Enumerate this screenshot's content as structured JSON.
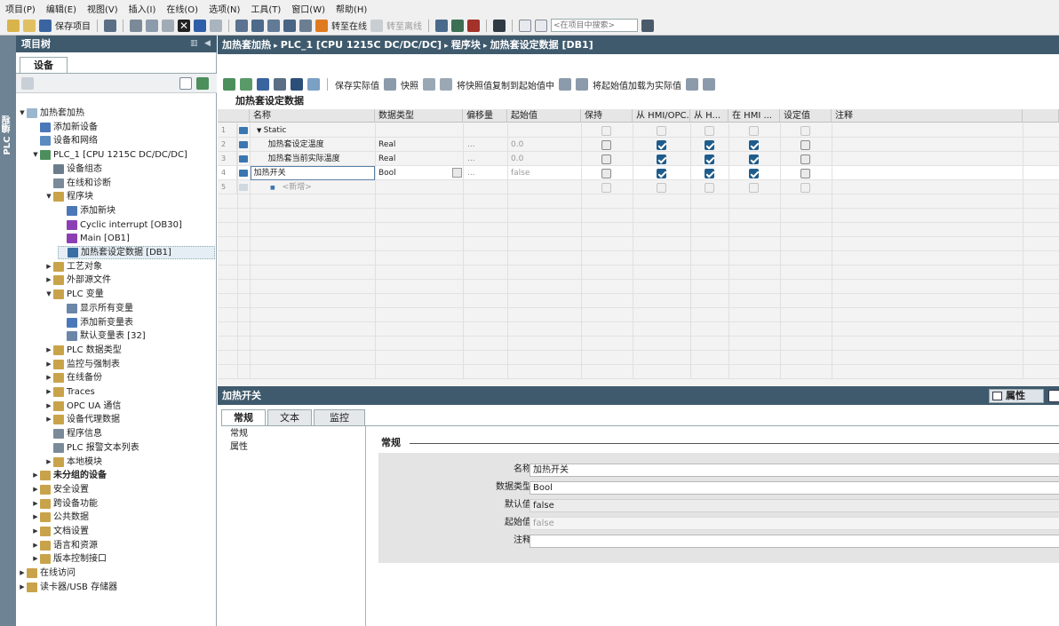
{
  "menu": [
    "项目(P)",
    "编辑(E)",
    "视图(V)",
    "插入(I)",
    "在线(O)",
    "选项(N)",
    "工具(T)",
    "窗口(W)",
    "帮助(H)"
  ],
  "toolbar": {
    "save_project": "保存项目",
    "go_online": "转至在线",
    "go_offline": "转至离线",
    "search_placeholder": "<在项目中搜索>"
  },
  "vertical_tab": "PLC 编程",
  "tree": {
    "header": "项目树",
    "tab_devices": "设备",
    "items": [
      {
        "label": "加热套加热",
        "level": 0,
        "arrow": "▼",
        "color": "#9bb6cf"
      },
      {
        "label": "添加新设备",
        "level": 1,
        "arrow": "",
        "color": "#4b78b8"
      },
      {
        "label": "设备和网络",
        "level": 1,
        "arrow": "",
        "color": "#5b8bc0"
      },
      {
        "label": "PLC_1 [CPU 1215C DC/DC/DC]",
        "level": 1,
        "arrow": "▼",
        "color": "#4c8f5c"
      },
      {
        "label": "设备组态",
        "level": 2,
        "arrow": "",
        "color": "#6b7d8c"
      },
      {
        "label": "在线和诊断",
        "level": 2,
        "arrow": "",
        "color": "#7a8a99"
      },
      {
        "label": "程序块",
        "level": 2,
        "arrow": "▼",
        "color": "#c9a34a"
      },
      {
        "label": "添加新块",
        "level": 3,
        "arrow": "",
        "color": "#4b78b8"
      },
      {
        "label": "Cyclic interrupt [OB30]",
        "level": 3,
        "arrow": "",
        "color": "#8c3fb4"
      },
      {
        "label": "Main [OB1]",
        "level": 3,
        "arrow": "",
        "color": "#8c3fb4"
      },
      {
        "label": "加热套设定数据 [DB1]",
        "level": 3,
        "arrow": "",
        "color": "#3b6ea5",
        "selected": true
      },
      {
        "label": "工艺对象",
        "level": 2,
        "arrow": "▶",
        "color": "#c9a34a"
      },
      {
        "label": "外部源文件",
        "level": 2,
        "arrow": "▶",
        "color": "#c9a34a"
      },
      {
        "label": "PLC 变量",
        "level": 2,
        "arrow": "▼",
        "color": "#c9a34a"
      },
      {
        "label": "显示所有变量",
        "level": 3,
        "arrow": "",
        "color": "#6a86a8"
      },
      {
        "label": "添加新变量表",
        "level": 3,
        "arrow": "",
        "color": "#4b78b8"
      },
      {
        "label": "默认变量表 [32]",
        "level": 3,
        "arrow": "",
        "color": "#6a86a8"
      },
      {
        "label": "PLC 数据类型",
        "level": 2,
        "arrow": "▶",
        "color": "#c9a34a"
      },
      {
        "label": "监控与强制表",
        "level": 2,
        "arrow": "▶",
        "color": "#c9a34a"
      },
      {
        "label": "在线备份",
        "level": 2,
        "arrow": "▶",
        "color": "#c9a34a"
      },
      {
        "label": "Traces",
        "level": 2,
        "arrow": "▶",
        "color": "#c9a34a"
      },
      {
        "label": "OPC UA 通信",
        "level": 2,
        "arrow": "▶",
        "color": "#c9a34a"
      },
      {
        "label": "设备代理数据",
        "level": 2,
        "arrow": "▶",
        "color": "#c9a34a"
      },
      {
        "label": "程序信息",
        "level": 2,
        "arrow": "",
        "color": "#7a8a99"
      },
      {
        "label": "PLC 报警文本列表",
        "level": 2,
        "arrow": "",
        "color": "#7a8a99"
      },
      {
        "label": "本地模块",
        "level": 2,
        "arrow": "▶",
        "color": "#c9a34a"
      },
      {
        "label": "未分组的设备",
        "level": 1,
        "arrow": "▶",
        "color": "#c9a34a",
        "bold": true
      },
      {
        "label": "安全设置",
        "level": 1,
        "arrow": "▶",
        "color": "#c9a34a"
      },
      {
        "label": "跨设备功能",
        "level": 1,
        "arrow": "▶",
        "color": "#c9a34a"
      },
      {
        "label": "公共数据",
        "level": 1,
        "arrow": "▶",
        "color": "#c9a34a"
      },
      {
        "label": "文档设置",
        "level": 1,
        "arrow": "▶",
        "color": "#c9a34a"
      },
      {
        "label": "语言和资源",
        "level": 1,
        "arrow": "▶",
        "color": "#c9a34a"
      },
      {
        "label": "版本控制接口",
        "level": 1,
        "arrow": "▶",
        "color": "#c9a34a"
      },
      {
        "label": "在线访问",
        "level": 0,
        "arrow": "▶",
        "color": "#c9a34a"
      },
      {
        "label": "读卡器/USB 存储器",
        "level": 0,
        "arrow": "▶",
        "color": "#c9a34a"
      }
    ]
  },
  "editor": {
    "breadcrumb": [
      "加热套加热",
      "PLC_1 [CPU 1215C DC/DC/DC]",
      "程序块",
      "加热套设定数据 [DB1]"
    ],
    "tools": {
      "snapshot_actual": "保存实际值",
      "snapshot": "快照",
      "copy_snapshot": "将快照值复制到起始值中",
      "load_start": "将起始值加载为实际值"
    },
    "db_title": "加热套设定数据",
    "columns": [
      "名称",
      "数据类型",
      "偏移量",
      "起始值",
      "保持",
      "从 HMI/OPC...",
      "从 H...",
      "在 HMI ...",
      "设定值",
      "注释"
    ],
    "rows": [
      {
        "no": "1",
        "name": "Static",
        "type": "",
        "offset": "",
        "start": "",
        "retain": false,
        "hmi_access": false,
        "hmi_visible": false,
        "hmi_write": false,
        "setpoint": false,
        "comment": "",
        "header": true
      },
      {
        "no": "2",
        "name": "加热套设定温度",
        "type": "Real",
        "offset": "...",
        "start": "0.0",
        "retain": false,
        "hmi_access": true,
        "hmi_visible": true,
        "hmi_write": true,
        "setpoint": false,
        "comment": ""
      },
      {
        "no": "3",
        "name": "加热套当前实际温度",
        "type": "Real",
        "offset": "...",
        "start": "0.0",
        "retain": false,
        "hmi_access": true,
        "hmi_visible": true,
        "hmi_write": true,
        "setpoint": false,
        "comment": ""
      },
      {
        "no": "4",
        "name": "加热开关",
        "type": "Bool",
        "offset": "...",
        "start": "false",
        "retain": false,
        "hmi_access": true,
        "hmi_visible": true,
        "hmi_write": true,
        "setpoint": false,
        "comment": ""
      },
      {
        "no": "5",
        "name": "<新增>",
        "type": "",
        "offset": "",
        "start": "",
        "retain": false,
        "hmi_access": false,
        "hmi_visible": false,
        "hmi_write": false,
        "setpoint": false,
        "comment": "",
        "new": true
      }
    ]
  },
  "properties": {
    "title": "加热开关",
    "button": "属性",
    "tabs": [
      "常规",
      "文本",
      "监控"
    ],
    "nav": [
      "常规",
      "属性"
    ],
    "section": "常规",
    "fields": [
      {
        "label": "名称",
        "value": "加热开关",
        "state": "edit"
      },
      {
        "label": "数据类型",
        "value": "Bool",
        "state": "edit"
      },
      {
        "label": "默认值",
        "value": "false",
        "state": "ro"
      },
      {
        "label": "起始值",
        "value": "false",
        "state": "dis"
      },
      {
        "label": "注释",
        "value": "",
        "state": "edit"
      }
    ]
  },
  "colors": {
    "header_bg": "#3f5a6d",
    "checkbox_on": "#1e5c8c",
    "strip": "#6e8394"
  }
}
